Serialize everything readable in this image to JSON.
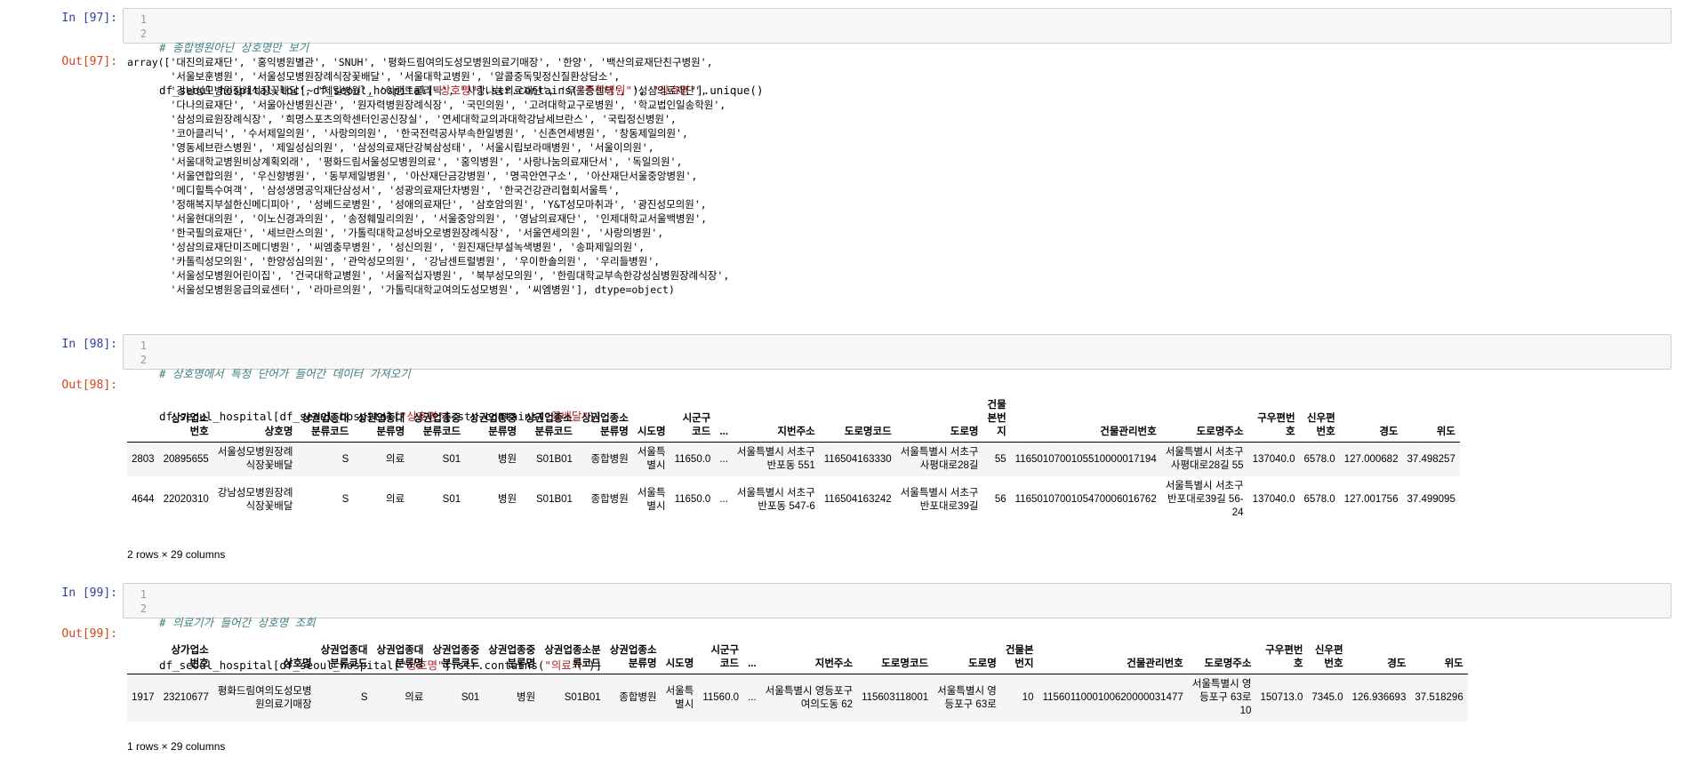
{
  "cells": [
    {
      "in_prompt": "In [97]:",
      "line_numbers": [
        "1",
        "2"
      ],
      "code_comment": "# 종합병원아닌 상호명만 보기",
      "code_line2": [
        {
          "t": "df_seoul_hospital.loc[~df_seoul_hospital[",
          "c": ""
        },
        {
          "t": "\"상호명\"",
          "c": "str"
        },
        {
          "t": "].str.contains(",
          "c": ""
        },
        {
          "t": "\"종합병원\"",
          "c": "str"
        },
        {
          "t": "), ",
          "c": ""
        },
        {
          "t": "\"상호명\"",
          "c": "str"
        },
        {
          "t": "].unique()",
          "c": ""
        }
      ],
      "out_prompt": "Out[97]:",
      "output_lines": [
        "array(['대진의료재단', '홍익병원별관', 'SNUH', '평화드림여의도성모병원의료기매장', '한양', '백산의료재단친구병원',",
        "       '서울보훈병원', '서울성모병원장례식장꽃배달', '서울대학교병원', '알콜중독및정신질환상담소',",
        "       '강남성모병원장례식장꽃배달', '제일병원', '이랜드클리닉', '사랑나눔의료재단', '우울증센터', '성심의료재단',",
        "       '다나의료재단', '서울아산병원신관', '원자력병원장례식장', '국민의원', '고려대학교구로병원', '학교법인일송학원',",
        "       '삼성의료원장례식장', '희명스포츠의학센터인공신장실', '연세대학교의과대학강남세브란스', '국립정신병원',",
        "       '코아클리닉', '수서제일의원', '사랑의의원', '한국전력공사부속한일병원', '신촌연세병원', '창동제일의원',",
        "       '영동세브란스병원', '제일성심의원', '삼성의료재단강북삼성태', '서울시립보라매병원', '서울이의원',",
        "       '서울대학교병원비상계획외래', '평화드림서울성모병원의료', '홍익병원', '사랑나눔의료재단서', '독일의원',",
        "       '서울연합의원', '우신향병원', '동부제일병원', '아산재단금강병원', '명곡안연구소', '아산재단서울중앙병원',",
        "       '메디힐특수여객', '삼성생명공익재단삼성서', '성광의료재단차병원', '한국건강관리협회서울특',",
        "       '정해복지부설한신메디피아', '성베드로병원', '성애의료재단', '삼호암의원', 'Y&T성모마취과', '광진성모의원',",
        "       '서울현대의원', '이노신경과의원', '송정훼밀리의원', '서울중앙의원', '영남의료재단', '인제대학교서울백병원',",
        "       '한국필의료재단', '세브란스의원', '가톨릭대학교성바오로병원장례식장', '서울연세의원', '사랑의병원',",
        "       '성삼의료재단미즈메디병원', '씨엠충무병원', '성신의원', '원진재단부설녹색병원', '송파제일의원',",
        "       '카톨릭성모의원', '한양성심의원', '관악성모의원', '강남센트럴병원', '우이한솔의원', '우리들병원',",
        "       '서울성모병원어린이집', '건국대학교병원', '서울적십자병원', '북부성모의원', '한림대학교부속한강성심병원장례식장',",
        "       '서울성모병원응급의료센터', '라마르의원', '가톨릭대학교여의도성모병원', '씨엠병원'], dtype=object)"
      ]
    },
    {
      "in_prompt": "In [98]:",
      "line_numbers": [
        "1",
        "2"
      ],
      "code_comment": "# 상호명에서 특정 단어가 들어간 데이터 가져오기",
      "code_line2": [
        {
          "t": "df_seoul_hospital[df_seoul_hospital[",
          "c": ""
        },
        {
          "t": "\"상호명\"",
          "c": "str"
        },
        {
          "t": "].str.contains(",
          "c": ""
        },
        {
          "t": "\"꽃배달\"",
          "c": "str"
        },
        {
          "t": ")]",
          "c": ""
        }
      ],
      "out_prompt": "Out[98]:",
      "columns": [
        "",
        "상가업소\n번호",
        "상호명",
        "상권업종대\n분류코드",
        "상권업종대\n분류명",
        "상권업종중\n분류코드",
        "상권업종중\n분류명",
        "상권업종소\n분류코드",
        "상권업종소\n분류명",
        "시도명",
        "시군구\n코드",
        "...",
        "지번주소",
        "도로명코드",
        "도로명",
        "건물\n본번\n지",
        "건물관리번호",
        "도로명주소",
        "구우편번\n호",
        "신우편\n번호",
        "경도",
        "위도"
      ],
      "rows": [
        [
          "2803",
          "20895655",
          "서울성모병원장례\n식장꽃배달",
          "S",
          "의료",
          "S01",
          "병원",
          "S01B01",
          "종합병원",
          "서울특\n별시",
          "11650.0",
          "...",
          "서울특별시 서초구\n반포동 551",
          "116504163330",
          "서울특별시 서초구\n사평대로28길",
          "55",
          "1165010700105510000017194",
          "서울특별시 서초구\n사평대로28길 55",
          "137040.0",
          "6578.0",
          "127.000682",
          "37.498257"
        ],
        [
          "4644",
          "22020310",
          "강남성모병원장례\n식장꽃배달",
          "S",
          "의료",
          "S01",
          "병원",
          "S01B01",
          "종합병원",
          "서울특\n별시",
          "11650.0",
          "...",
          "서울특별시 서초구\n반포동 547-6",
          "116504163242",
          "서울특별시 서초구\n반포대로39길",
          "56",
          "1165010700105470006016762",
          "서울특별시 서초구\n반포대로39길 56-\n24",
          "137040.0",
          "6578.0",
          "127.001756",
          "37.499095"
        ]
      ],
      "shape": "2 rows × 29 columns"
    },
    {
      "in_prompt": "In [99]:",
      "line_numbers": [
        "1",
        "2"
      ],
      "code_comment": "# 의료기가 들어간 상호명 조회",
      "code_line2": [
        {
          "t": "df_seoul_hospital[df_seoul_hospital[",
          "c": ""
        },
        {
          "t": "\"상호명\"",
          "c": "str"
        },
        {
          "t": "].str.contains(",
          "c": ""
        },
        {
          "t": "\"의료기\"",
          "c": "str"
        },
        {
          "t": ")]",
          "c": ""
        }
      ],
      "out_prompt": "Out[99]:",
      "columns": [
        "",
        "상가업소\n번호",
        "상호명",
        "상권업종대\n분류코드",
        "상권업종대\n분류명",
        "상권업종중\n분류코드",
        "상권업종중\n분류명",
        "상권업종소분\n류코드",
        "상권업종소\n분류명",
        "시도명",
        "시군구\n코드",
        "...",
        "지번주소",
        "도로명코드",
        "도로명",
        "건물본\n번지",
        "건물관리번호",
        "도로명주소",
        "구우편번\n호",
        "신우편\n번호",
        "경도",
        "위도"
      ],
      "rows": [
        [
          "1917",
          "23210677",
          "평화드림여의도성모병\n원의료기매장",
          "S",
          "의료",
          "S01",
          "병원",
          "S01B01",
          "종합병원",
          "서울특\n별시",
          "11560.0",
          "...",
          "서울특별시 영등포구\n여의도동 62",
          "115603118001",
          "서울특별시 영\n등포구 63로",
          "10",
          "1156011000100620000031477",
          "서울특별시 영\n등포구 63로\n10",
          "150713.0",
          "7345.0",
          "126.936693",
          "37.518296"
        ]
      ],
      "shape": "1 rows × 29 columns"
    }
  ]
}
